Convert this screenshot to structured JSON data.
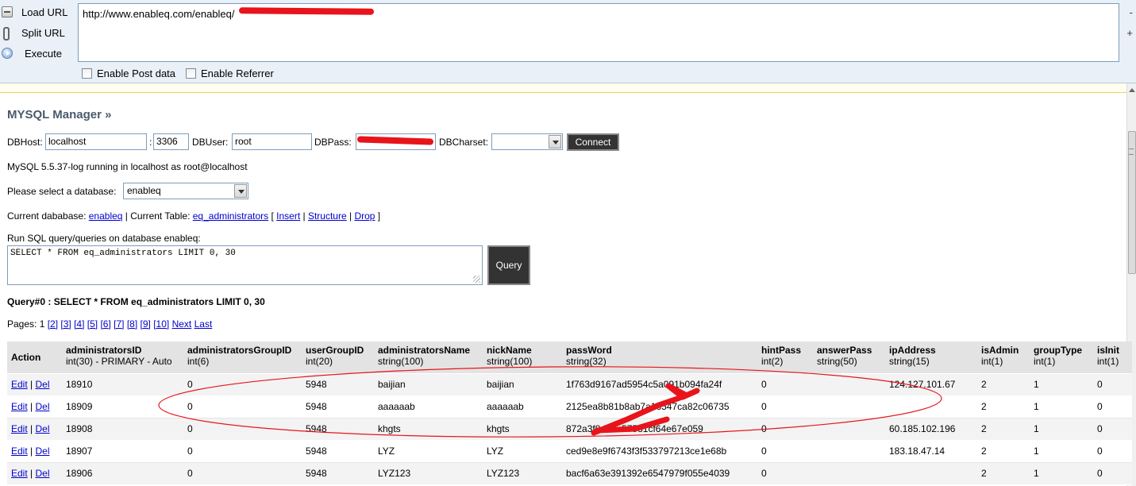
{
  "hackbar": {
    "buttons": [
      {
        "label": "Load URL",
        "icon": "load-url-icon"
      },
      {
        "label": "Split URL",
        "icon": "split-url-icon"
      },
      {
        "label": "Execute",
        "icon": "execute-icon"
      }
    ],
    "url_value": "http://www.enableq.com/enableq/",
    "side_marks": [
      "-",
      "+"
    ],
    "enable_post_label": "Enable Post data",
    "enable_referrer_label": "Enable Referrer"
  },
  "manager": {
    "title": "MYSQL Manager »",
    "dbhost_label": "DBHost:",
    "dbhost_value": "localhost",
    "colon": ":",
    "port_value": "3306",
    "dbuser_label": "DBUser:",
    "dbuser_value": "root",
    "dbpass_label": "DBPass:",
    "dbcharset_label": "DBCharset:",
    "connect_label": "Connect",
    "status_text": "MySQL 5.5.37-log running in localhost as root@localhost",
    "select_db_label": "Please select a database:",
    "selected_db": "enableq",
    "current_db_label": "Current dababase:",
    "current_db_link": "enableq",
    "current_table_label": " | Current Table: ",
    "current_table_link": "eq_administrators",
    "bracket_open": " [ ",
    "insert_link": "Insert",
    "structure_link": "Structure",
    "drop_link": "Drop",
    "sep": " | ",
    "bracket_close": " ]",
    "run_sql_label": "Run SQL query/queries on database enableq:",
    "sql_text": "SELECT * FROM eq_administrators LIMIT 0, 30",
    "query_button": "Query",
    "query_result_title": "Query#0 : SELECT * FROM eq_administrators LIMIT 0, 30",
    "pages_label": "Pages: 1",
    "page_links": [
      "[2]",
      "[3]",
      "[4]",
      "[5]",
      "[6]",
      "[7]",
      "[8]",
      "[9]",
      "[10]",
      "Next",
      "Last"
    ]
  },
  "table": {
    "columns": [
      {
        "name": "Action",
        "type": ""
      },
      {
        "name": "administratorsID",
        "type": "int(30) - PRIMARY - Auto"
      },
      {
        "name": "administratorsGroupID",
        "type": "int(6)"
      },
      {
        "name": "userGroupID",
        "type": "int(20)"
      },
      {
        "name": "administratorsName",
        "type": "string(100)"
      },
      {
        "name": "nickName",
        "type": "string(100)"
      },
      {
        "name": "passWord",
        "type": "string(32)"
      },
      {
        "name": "hintPass",
        "type": "int(2)"
      },
      {
        "name": "answerPass",
        "type": "string(50)"
      },
      {
        "name": "ipAddress",
        "type": "string(15)"
      },
      {
        "name": "isAdmin",
        "type": "int(1)"
      },
      {
        "name": "groupType",
        "type": "int(1)"
      },
      {
        "name": "isInit",
        "type": "int(1)"
      }
    ],
    "edit_label": "Edit",
    "del_label": "Del",
    "action_sep": " | ",
    "rows": [
      [
        "18910",
        "0",
        "5948",
        "baijian",
        "baijian",
        "1f763d9167ad5954c5a091b094fa24f",
        "0",
        "",
        "124.127.101.67",
        "2",
        "1",
        "0"
      ],
      [
        "18909",
        "0",
        "5948",
        "aaaaaab",
        "aaaaaab",
        "2125ea8b81b8ab7a16547ca82c06735",
        "0",
        "",
        "",
        "2",
        "1",
        "0"
      ],
      [
        "18908",
        "0",
        "5948",
        "khgts",
        "khgts",
        "872a3f8d0da57581cf64e67e059",
        "0",
        "",
        "60.185.102.196",
        "2",
        "1",
        "0"
      ],
      [
        "18907",
        "0",
        "5948",
        "LYZ",
        "LYZ",
        "ced9e8e9f6743f3f533797213ce1e68b",
        "0",
        "",
        "183.18.47.14",
        "2",
        "1",
        "0"
      ],
      [
        "18906",
        "0",
        "5948",
        "LYZ123",
        "LYZ123",
        "bacf6a63e391392e6547979f055e4039",
        "0",
        "",
        "",
        "2",
        "1",
        "0"
      ]
    ]
  },
  "annotation_color": "#e8141b"
}
